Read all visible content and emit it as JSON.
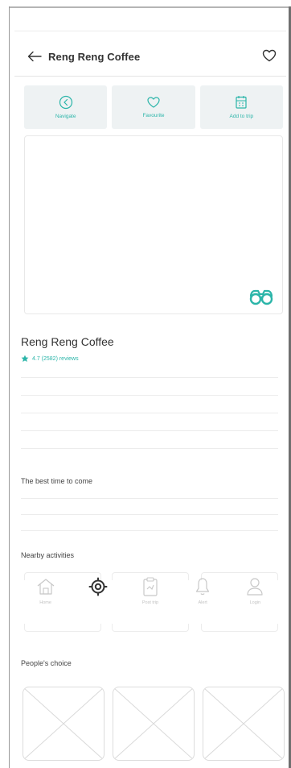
{
  "header": {
    "title": "Reng Reng Coffee"
  },
  "actions": [
    {
      "label": "Navigate",
      "icon": "navigate-icon"
    },
    {
      "label": "Favourite",
      "icon": "heart-icon"
    },
    {
      "label": "Add to trip",
      "icon": "calendar-icon"
    }
  ],
  "place": {
    "name": "Reng Reng Coffee",
    "rating_text": "4.7 (2582) reviews",
    "rating": 4.7
  },
  "sections": {
    "best_time": "The best time to come",
    "nearby": "Nearby activities",
    "peoples_choice": "People's choice"
  },
  "nav": [
    {
      "label": "Home",
      "icon": "home-icon"
    },
    {
      "label": "",
      "icon": "location-target-icon"
    },
    {
      "label": "Post trip",
      "icon": "clipboard-icon"
    },
    {
      "label": "Alert",
      "icon": "bell-icon"
    },
    {
      "label": "Login",
      "icon": "user-icon"
    }
  ],
  "colors": {
    "accent": "#2bb5a9",
    "tile_bg": "#eef2f3",
    "placeholder_gray": "#d9d9d9"
  }
}
